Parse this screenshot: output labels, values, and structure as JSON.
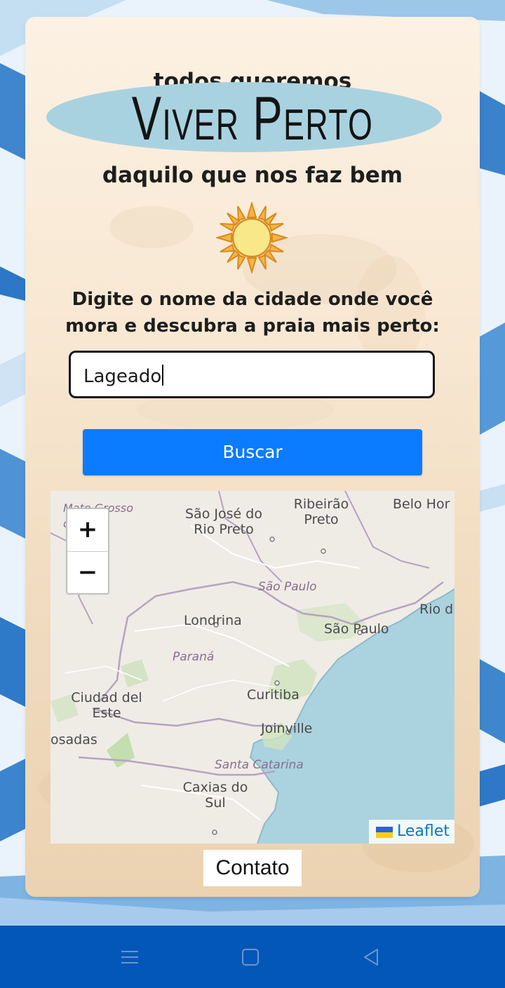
{
  "header": {
    "tagline_top": "todos queremos",
    "title": "Viver Perto",
    "tagline_bottom": "daquilo que nos faz bem"
  },
  "instruction": "Digite o nome da cidade onde você mora e descubra a praia mais perto:",
  "search": {
    "value": "Lageado",
    "button_label": "Buscar"
  },
  "map": {
    "zoom_in": "+",
    "zoom_out": "−",
    "attribution": "Leaflet",
    "cities": [
      {
        "id": "mato-grosso",
        "text": "Mato Grosso do Sul"
      },
      {
        "id": "sao-jose",
        "text": "São José do Rio Preto"
      },
      {
        "id": "ribeirao",
        "text": "Ribeirão Preto"
      },
      {
        "id": "belo-horizonte",
        "text": "Belo Hor"
      },
      {
        "id": "londrina",
        "text": "Londrina"
      },
      {
        "id": "sao-paulo-city",
        "text": "São Paulo"
      },
      {
        "id": "rio",
        "text": "Rio d"
      },
      {
        "id": "ciudad-del-este",
        "text": "Ciudad del Este"
      },
      {
        "id": "curitiba",
        "text": "Curitiba"
      },
      {
        "id": "joinville",
        "text": "Joinville"
      },
      {
        "id": "posadas",
        "text": "osadas"
      },
      {
        "id": "caxias",
        "text": "Caxias do Sul"
      }
    ],
    "states": [
      {
        "id": "sao-paulo-state",
        "text": "São Paulo"
      },
      {
        "id": "parana",
        "text": "Paraná"
      },
      {
        "id": "santa-catarina",
        "text": "Santa Catarina"
      }
    ]
  },
  "footer": {
    "contact_label": "Contato"
  },
  "colors": {
    "button": "#0b7bff",
    "title_ellipse": "#a9d2e0",
    "navbar": "#0257b8",
    "ocean": "#aad3df"
  }
}
